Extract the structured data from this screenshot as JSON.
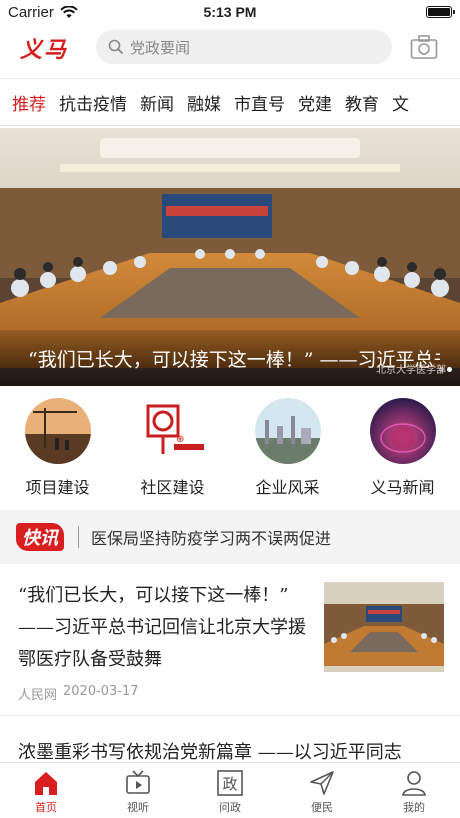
{
  "status": {
    "carrier": "Carrier",
    "time": "5:13 PM"
  },
  "header": {
    "logo": "义马",
    "search_placeholder": "党政要闻"
  },
  "tabs": [
    "推荐",
    "抗击疫情",
    "新闻",
    "融媒",
    "市直号",
    "党建",
    "教育",
    "文"
  ],
  "banner": {
    "caption": "“我们已长大，可以接下这一棒！” ——习近平总书记回信让北京大学援鄂医疗队备受鼓舞",
    "source": "北京大学医学部"
  },
  "categories": [
    {
      "label": "项目建设",
      "icon": "construction-crane-icon"
    },
    {
      "label": "社区建设",
      "icon": "community-logo-icon"
    },
    {
      "label": "企业风采",
      "icon": "factory-icon"
    },
    {
      "label": "义马新闻",
      "icon": "globe-news-icon"
    }
  ],
  "flash": {
    "badge": "快讯",
    "text": "医保局坚持防疫学习两不误两促进"
  },
  "article": {
    "title": "“我们已长大，可以接下这一棒！” ——习近平总书记回信让北京大学援鄂医疗队备受鼓舞",
    "source": "人民网",
    "date": "2020-03-17"
  },
  "article2": {
    "title": "浓墨重彩书写依规治党新篇章 ——以习近平同志"
  },
  "nav": [
    {
      "label": "首页",
      "icon": "home-icon"
    },
    {
      "label": "视听",
      "icon": "tv-icon"
    },
    {
      "label": "问政",
      "icon": "politics-icon"
    },
    {
      "label": "便民",
      "icon": "send-icon"
    },
    {
      "label": "我的",
      "icon": "user-icon"
    }
  ],
  "colors": {
    "accent": "#d81e1e"
  }
}
